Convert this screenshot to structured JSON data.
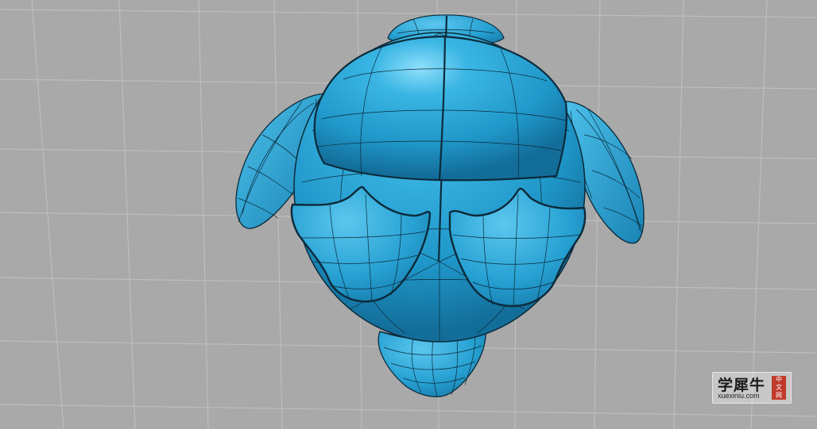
{
  "viewport": {
    "background": "#a9a9a9",
    "grid_color": "#bdbdbd",
    "model_fill": "#2aa6d8",
    "model_shadow": "#1679a8",
    "model_highlight": "#7fd6f5",
    "isocurve_color": "#0b2a3a",
    "model_description_icon": "character-head-3d-model-icon"
  },
  "watermark": {
    "title": "学犀牛",
    "domain": "xuexiniu.com",
    "seal": [
      "中",
      "文",
      "网"
    ],
    "seal_color": "#c0392b"
  }
}
